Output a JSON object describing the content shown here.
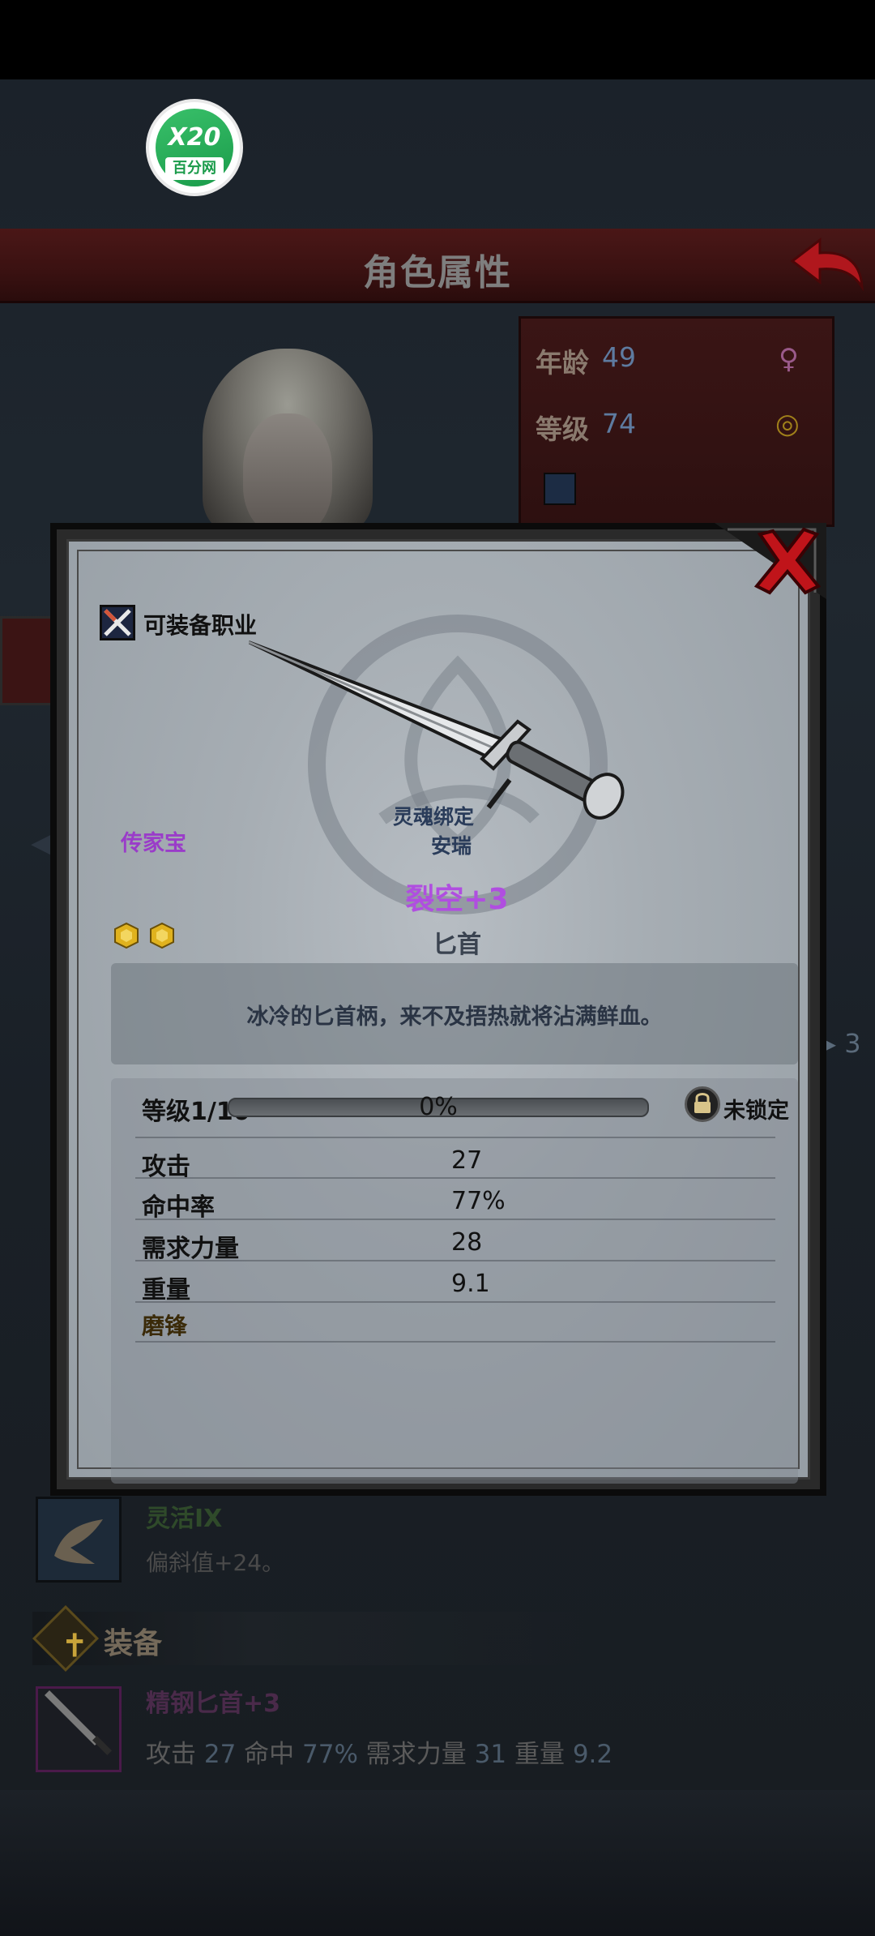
{
  "logo": {
    "top_text": "X20",
    "bottom_text": "百分网"
  },
  "header": {
    "title": "角色属性"
  },
  "character": {
    "age_label": "年龄",
    "age_value": "49",
    "level_label": "等级",
    "level_value": "74"
  },
  "side": {
    "counter": "3"
  },
  "dialog": {
    "class_label": "可装备职业",
    "soulbound_label": "灵魂绑定",
    "soulbound_owner": "安瑞",
    "rarity_label": "传家宝",
    "item_name": "裂空+3",
    "item_type": "匕首",
    "description": "冰冷的匕首柄，来不及捂热就将沾满鲜血。",
    "level_label": "等级1/10",
    "level_progress": 0,
    "level_percent": "0%",
    "lock_label": "未锁定",
    "stats": [
      {
        "label": "攻击",
        "value": "27"
      },
      {
        "label": "命中率",
        "value": "77%"
      },
      {
        "label": "需求力量",
        "value": "28"
      },
      {
        "label": "重量",
        "value": "9.1"
      }
    ],
    "sharpen_label": "磨锋",
    "gems": [
      "hex-gem-icon",
      "hex-gem-icon"
    ]
  },
  "skill": {
    "title": "灵活IX",
    "description": "偏斜值+24。"
  },
  "equipment": {
    "header": "装备",
    "item_name": "精钢匕首+3",
    "attack_label": "攻击",
    "attack_value": "27",
    "hit_label": "命中",
    "hit_value": "77%",
    "str_label": "需求力量",
    "str_value": "31",
    "weight_label": "重量",
    "weight_value": "9.2"
  },
  "colors": {
    "title_bar": "#3a1111",
    "rarity_purple": "#b04ee0",
    "close_red": "#c0141a",
    "back_red": "#b0171d"
  }
}
